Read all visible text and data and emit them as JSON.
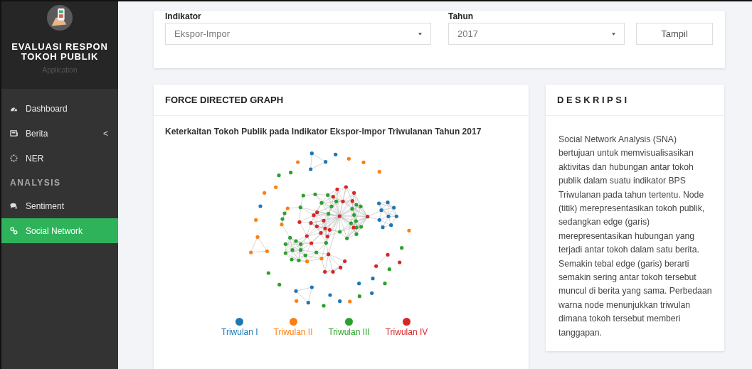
{
  "sidebar": {
    "brand_title": "EVALUASI RESPON TOKOH PUBLIK",
    "brand_subtitle": "Application",
    "menu": [
      {
        "label": "Dashboard",
        "selected": false
      },
      {
        "label": "Berita",
        "selected": false,
        "submenu_indicator": "<"
      },
      {
        "label": "NER",
        "selected": false
      }
    ],
    "section_heading": "ANALYSIS",
    "analysis_menu": [
      {
        "label": "Sentiment",
        "selected": false
      },
      {
        "label": "Social Network",
        "selected": true
      }
    ]
  },
  "filters": {
    "indikator": {
      "label": "Indikator",
      "value": "Ekspor-Impor"
    },
    "tahun": {
      "label": "Tahun",
      "value": "2017"
    },
    "button": "Tampil"
  },
  "graph_panel": {
    "title": "FORCE DIRECTED GRAPH",
    "subtitle": "Keterkaitan Tokoh Publik pada Indikator Ekspor-Impor Triwulanan Tahun 2017",
    "legend": [
      {
        "label": "Triwulan I",
        "color": "#1f77b4"
      },
      {
        "label": "Triwulan II",
        "color": "#ff7f0e"
      },
      {
        "label": "Triwulan III",
        "color": "#2ca02c"
      },
      {
        "label": "Triwulan IV",
        "color": "#d62728"
      }
    ]
  },
  "description_panel": {
    "title": "DESKRIPSI",
    "text": "Social Network Analysis (SNA) bertujuan untuk memvisualisasikan aktivitas dan hubungan antar tokoh publik dalam suatu indikator BPS Triwulanan pada tahun tertentu. Node (titik) merepresentasikan tokoh publik, sedangkan edge (garis) merepresentasikan hubungan yang terjadi antar tokoh dalam satu berita. Semakin tebal edge (garis) berarti semakin sering antar tokoh tersebut muncul di berita yang sama. Perbedaan warna node menunjukkan triwulan dimana tokoh tersebut memberi tanggapan."
  }
}
